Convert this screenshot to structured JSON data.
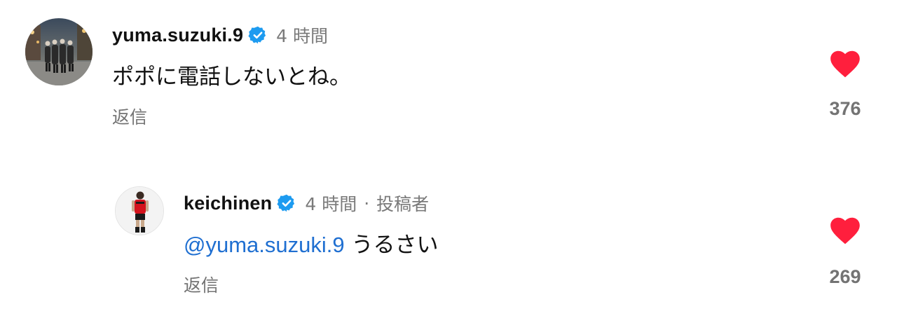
{
  "comments": [
    {
      "username": "yuma.suzuki.9",
      "verified": true,
      "time": "4 時間",
      "text": "ポポに電話しないとね。",
      "reply_label": "返信",
      "likes": "376",
      "liked": true
    },
    {
      "username": "keichinen",
      "verified": true,
      "time": "4 時間",
      "separator": "·",
      "author_label": "投稿者",
      "mention": "@yuma.suzuki.9",
      "text": " うるさい",
      "reply_label": "返信",
      "likes": "269",
      "liked": true
    }
  ],
  "colors": {
    "verified_blue": "#1d9bf0",
    "heart_red": "#ff1f3d",
    "mention_blue": "#1f6fd1",
    "meta_gray": "#7a7a7a"
  },
  "icons": {
    "verified": "verified-badge-icon",
    "like": "heart-filled-icon"
  }
}
